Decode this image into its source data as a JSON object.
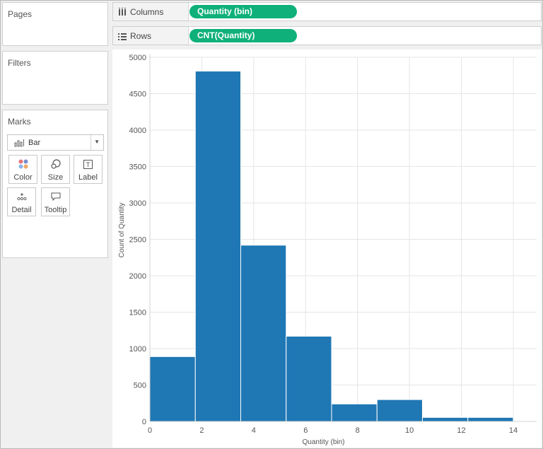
{
  "panels": {
    "pages_title": "Pages",
    "filters_title": "Filters",
    "marks_title": "Marks"
  },
  "marks": {
    "type_label": "Bar",
    "buttons": [
      "Color",
      "Size",
      "Label",
      "Detail",
      "Tooltip"
    ],
    "icons": [
      "bar-chart-icon",
      "color-dots-icon",
      "size-icon",
      "label-icon",
      "detail-dots-icon",
      "tooltip-icon"
    ]
  },
  "shelves": {
    "columns_label": "Columns",
    "columns_pill": "Quantity (bin)",
    "rows_label": "Rows",
    "rows_pill": "CNT(Quantity)"
  },
  "colors": {
    "bar": "#1f77b4",
    "pill": "#0fb07a",
    "grid": "#e6e6e6"
  },
  "chart_data": {
    "type": "bar",
    "title": "",
    "xlabel": "Quantity (bin)",
    "ylabel": "Count of Quantity",
    "bin_size": 1.75,
    "bins": [
      {
        "start": 0,
        "value": 890
      },
      {
        "start": 1.75,
        "value": 4810
      },
      {
        "start": 3.5,
        "value": 2420
      },
      {
        "start": 5.25,
        "value": 1170
      },
      {
        "start": 7,
        "value": 240
      },
      {
        "start": 8.75,
        "value": 300
      },
      {
        "start": 10.5,
        "value": 55
      },
      {
        "start": 12.25,
        "value": 55
      }
    ],
    "xlim": [
      0,
      14.9
    ],
    "ylim": [
      0,
      5000
    ],
    "xticks": [
      0,
      2,
      4,
      6,
      8,
      10,
      12,
      14
    ],
    "yticks": [
      0,
      500,
      1000,
      1500,
      2000,
      2500,
      3000,
      3500,
      4000,
      4500,
      5000
    ],
    "grid": true
  }
}
